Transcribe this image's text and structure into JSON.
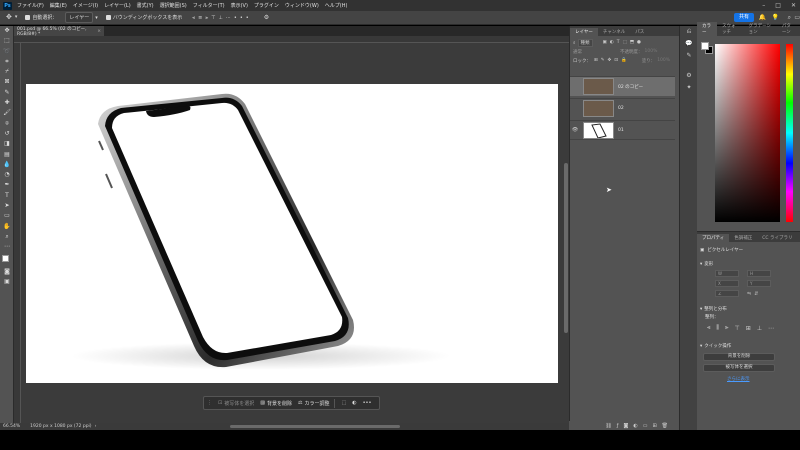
{
  "menubar": {
    "logo": "Ps",
    "items": [
      "ファイル(F)",
      "編集(E)",
      "イメージ(I)",
      "レイヤー(L)",
      "書式(Y)",
      "選択範囲(S)",
      "フィルター(T)",
      "表示(V)",
      "プラグイン",
      "ウィンドウ(W)",
      "ヘルプ(H)"
    ]
  },
  "options": {
    "auto_select_label": "自動選択：",
    "auto_select_value": "レイヤー",
    "bbox_label": "バウンディングボックスを表示",
    "share_label": "共有"
  },
  "document": {
    "tab_title": "001.psd @ 66.5% (02 のコピー, RGB/8#) *",
    "zoom_status": "66.54%",
    "size_status": "1920 px x 1080 px (72 ppi)"
  },
  "context_bar": {
    "select_subject": "被写体を選択",
    "remove_bg": "背景を削除",
    "color_adjust": "カラー調整"
  },
  "layers_panel": {
    "tabs": [
      "レイヤー",
      "チャンネル",
      "パス"
    ],
    "kind_filter": "種類",
    "blend_mode": "通常",
    "opacity_label": "不透明度：",
    "opacity_value": "100%",
    "lock_label": "ロック：",
    "fill_label": "塗り：",
    "fill_value": "100%",
    "layers": [
      {
        "name": "02 のコピー",
        "selected": true,
        "visible": false
      },
      {
        "name": "02",
        "selected": false,
        "visible": false
      },
      {
        "name": "01",
        "selected": false,
        "visible": true
      }
    ]
  },
  "color_panel": {
    "tabs": [
      "カラー",
      "スウォッチ",
      "グラデーション",
      "パターン"
    ]
  },
  "properties_panel": {
    "tabs": [
      "プロパティ",
      "色調補正",
      "CC ライブラリ"
    ],
    "layer_type": "ピクセルレイヤー",
    "transform_title": "変形",
    "align_title": "整列と分布",
    "align_sub": "整列：",
    "quick_actions_title": "クイック操作",
    "remove_bg_button": "背景を削除",
    "select_subject_button": "被写体を選択",
    "more_link": "さらに表示"
  },
  "colors": {
    "accent": "#1473e6",
    "panel_bg": "#535353",
    "workspace_bg": "#3b3b3b"
  }
}
